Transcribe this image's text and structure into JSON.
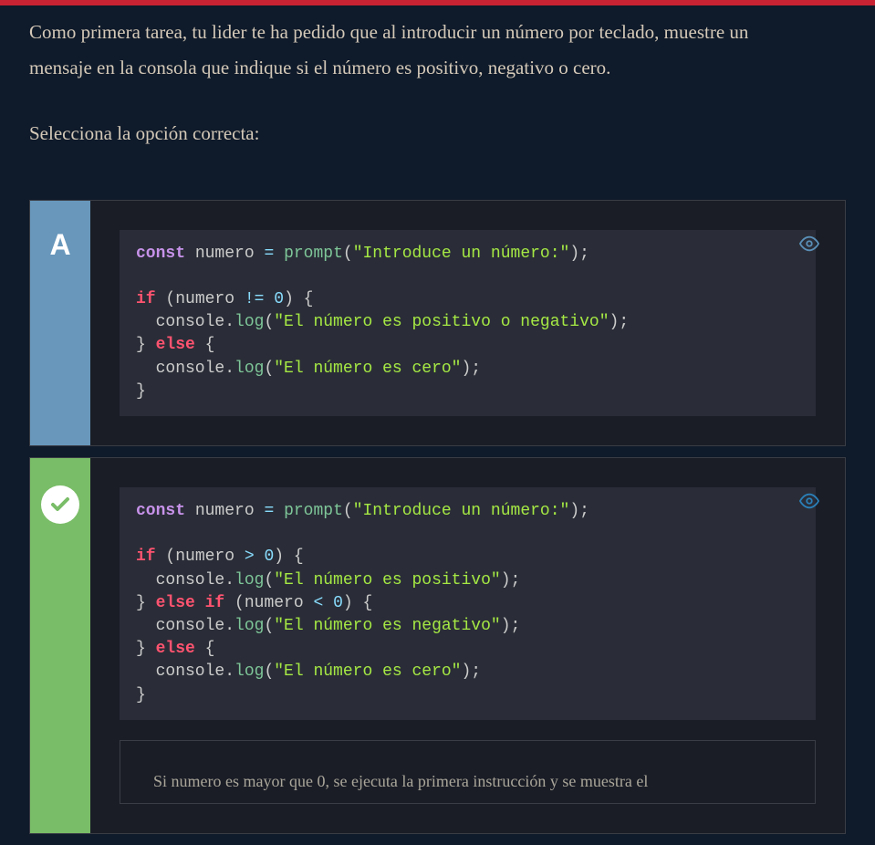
{
  "task_description": "Como primera tarea, tu lider te ha pedido que al introducir un número por teclado, muestre un mensaje en la consola que indique si el número es positivo, negativo o cero.",
  "instruction": "Selecciona la opción correcta:",
  "options": {
    "a": {
      "badge": "A",
      "code": {
        "tokens": [
          {
            "t": "kw",
            "v": "const"
          },
          {
            "t": "txt",
            "v": " numero "
          },
          {
            "t": "op",
            "v": "="
          },
          {
            "t": "txt",
            "v": " "
          },
          {
            "t": "fn-green",
            "v": "prompt"
          },
          {
            "t": "punct",
            "v": "("
          },
          {
            "t": "str",
            "v": "\"Introduce un número:\""
          },
          {
            "t": "punct",
            "v": ");"
          },
          {
            "t": "nl"
          },
          {
            "t": "nl"
          },
          {
            "t": "kw-red",
            "v": "if"
          },
          {
            "t": "txt",
            "v": " (numero "
          },
          {
            "t": "op",
            "v": "!="
          },
          {
            "t": "txt",
            "v": " "
          },
          {
            "t": "num",
            "v": "0"
          },
          {
            "t": "punct",
            "v": ") {"
          },
          {
            "t": "nl"
          },
          {
            "t": "txt",
            "v": "  console"
          },
          {
            "t": "punct",
            "v": "."
          },
          {
            "t": "fn-green",
            "v": "log"
          },
          {
            "t": "punct",
            "v": "("
          },
          {
            "t": "str",
            "v": "\"El número es positivo o negativo\""
          },
          {
            "t": "punct",
            "v": ");"
          },
          {
            "t": "nl"
          },
          {
            "t": "punct",
            "v": "} "
          },
          {
            "t": "kw-red",
            "v": "else"
          },
          {
            "t": "punct",
            "v": " {"
          },
          {
            "t": "nl"
          },
          {
            "t": "txt",
            "v": "  console"
          },
          {
            "t": "punct",
            "v": "."
          },
          {
            "t": "fn-green",
            "v": "log"
          },
          {
            "t": "punct",
            "v": "("
          },
          {
            "t": "str",
            "v": "\"El número es cero\""
          },
          {
            "t": "punct",
            "v": ");"
          },
          {
            "t": "nl"
          },
          {
            "t": "punct",
            "v": "}"
          }
        ]
      }
    },
    "b": {
      "correct": true,
      "code": {
        "tokens": [
          {
            "t": "kw",
            "v": "const"
          },
          {
            "t": "txt",
            "v": " numero "
          },
          {
            "t": "op",
            "v": "="
          },
          {
            "t": "txt",
            "v": " "
          },
          {
            "t": "fn-green",
            "v": "prompt"
          },
          {
            "t": "punct",
            "v": "("
          },
          {
            "t": "str",
            "v": "\"Introduce un número:\""
          },
          {
            "t": "punct",
            "v": ");"
          },
          {
            "t": "nl"
          },
          {
            "t": "nl"
          },
          {
            "t": "kw-red",
            "v": "if"
          },
          {
            "t": "txt",
            "v": " (numero "
          },
          {
            "t": "op",
            "v": ">"
          },
          {
            "t": "txt",
            "v": " "
          },
          {
            "t": "num",
            "v": "0"
          },
          {
            "t": "punct",
            "v": ") {"
          },
          {
            "t": "nl"
          },
          {
            "t": "txt",
            "v": "  console"
          },
          {
            "t": "punct",
            "v": "."
          },
          {
            "t": "fn-green",
            "v": "log"
          },
          {
            "t": "punct",
            "v": "("
          },
          {
            "t": "str",
            "v": "\"El número es positivo\""
          },
          {
            "t": "punct",
            "v": ");"
          },
          {
            "t": "nl"
          },
          {
            "t": "punct",
            "v": "} "
          },
          {
            "t": "kw-red",
            "v": "else if"
          },
          {
            "t": "txt",
            "v": " (numero "
          },
          {
            "t": "op",
            "v": "<"
          },
          {
            "t": "txt",
            "v": " "
          },
          {
            "t": "num",
            "v": "0"
          },
          {
            "t": "punct",
            "v": ") {"
          },
          {
            "t": "nl"
          },
          {
            "t": "txt",
            "v": "  console"
          },
          {
            "t": "punct",
            "v": "."
          },
          {
            "t": "fn-green",
            "v": "log"
          },
          {
            "t": "punct",
            "v": "("
          },
          {
            "t": "str",
            "v": "\"El número es negativo\""
          },
          {
            "t": "punct",
            "v": ");"
          },
          {
            "t": "nl"
          },
          {
            "t": "punct",
            "v": "} "
          },
          {
            "t": "kw-red",
            "v": "else"
          },
          {
            "t": "punct",
            "v": " {"
          },
          {
            "t": "nl"
          },
          {
            "t": "txt",
            "v": "  console"
          },
          {
            "t": "punct",
            "v": "."
          },
          {
            "t": "fn-green",
            "v": "log"
          },
          {
            "t": "punct",
            "v": "("
          },
          {
            "t": "str",
            "v": "\"El número es cero\""
          },
          {
            "t": "punct",
            "v": ");"
          },
          {
            "t": "nl"
          },
          {
            "t": "punct",
            "v": "}"
          }
        ]
      },
      "explanation": "Si numero es mayor que 0, se ejecuta la primera instrucción y se muestra el"
    }
  }
}
